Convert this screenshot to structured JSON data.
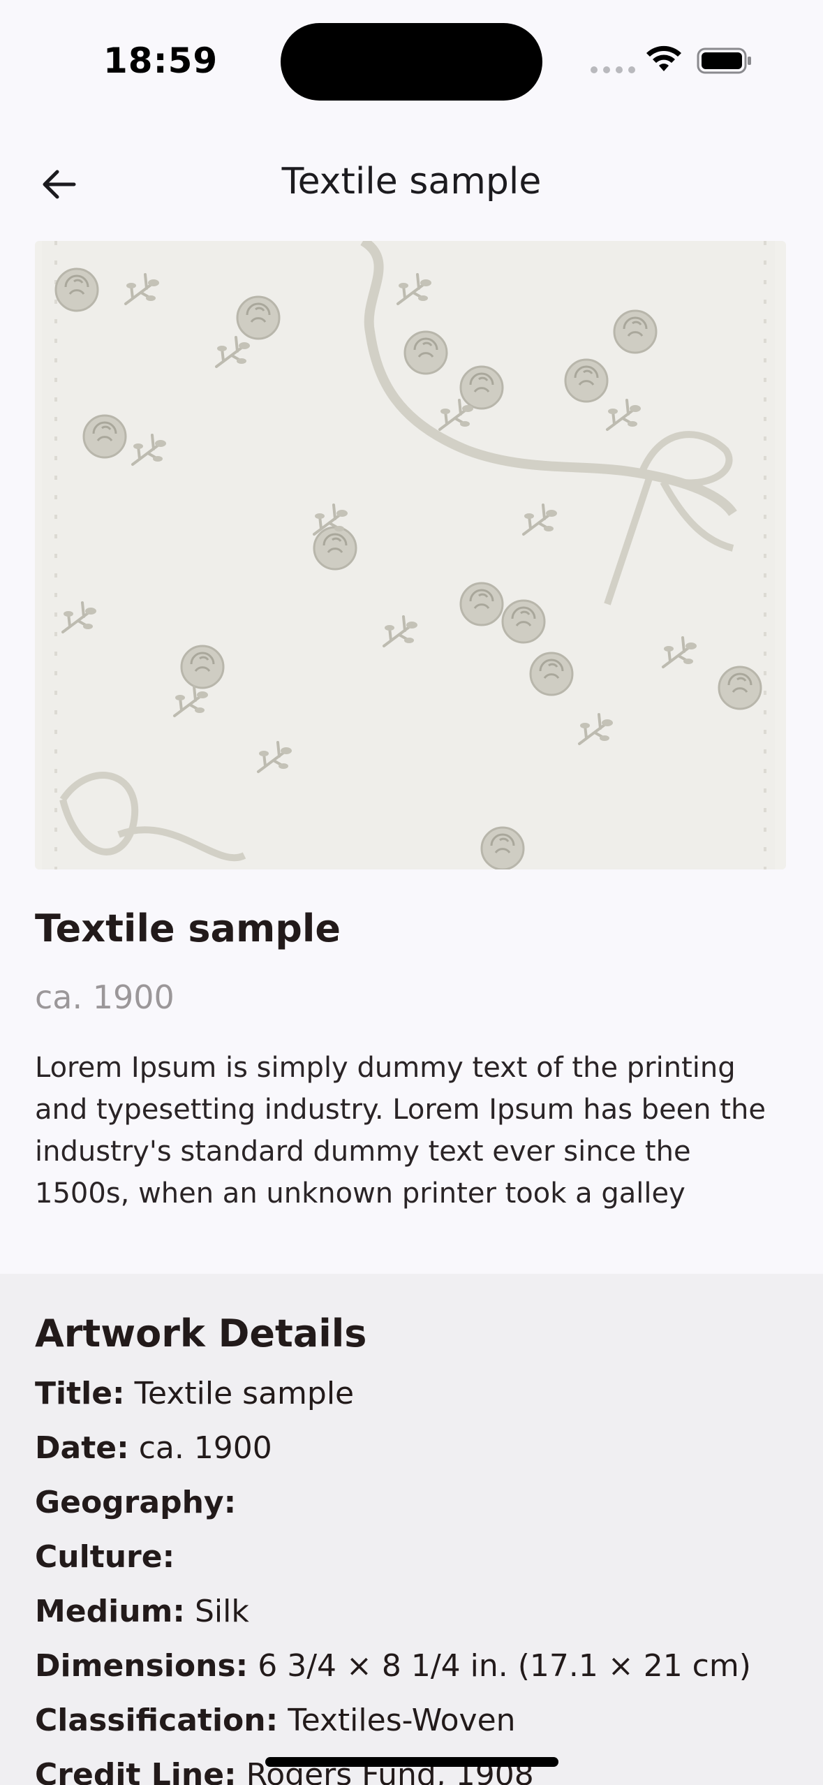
{
  "status_bar": {
    "time": "18:59"
  },
  "app_bar": {
    "title": "Textile sample"
  },
  "artwork": {
    "image_alt": "Textile sample"
  },
  "object": {
    "title": "Textile sample",
    "date": "ca. 1900",
    "description": "Lorem Ipsum is simply dummy text of the printing and typesetting industry. Lorem Ipsum has been the industry's standard dummy text ever since the 1500s, when an unknown printer took a galley"
  },
  "details": {
    "heading": "Artwork Details",
    "rows": [
      {
        "label": "Title:",
        "value": "Textile sample"
      },
      {
        "label": "Date:",
        "value": "ca. 1900"
      },
      {
        "label": "Geography:",
        "value": ""
      },
      {
        "label": "Culture:",
        "value": ""
      },
      {
        "label": "Medium:",
        "value": "Silk"
      },
      {
        "label": "Dimensions:",
        "value": "6 3/4 × 8 1/4 in. (17.1 × 21 cm)"
      },
      {
        "label": "Classification:",
        "value": "Textiles-Woven"
      },
      {
        "label": "Credit Line:",
        "value": "Rogers Fund, 1908"
      }
    ]
  },
  "colors": {
    "background": "#f9f8fc",
    "details_background": "#f0eff2",
    "text": "#221a1a",
    "muted_text": "#9b9799"
  },
  "icons": {
    "back": "arrow-left-icon",
    "wifi": "wifi-icon",
    "battery": "battery-icon",
    "signal": "cellular-signal-icon"
  }
}
